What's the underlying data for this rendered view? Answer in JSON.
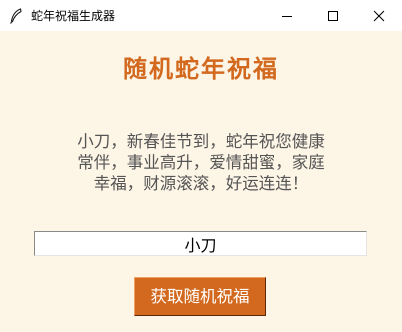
{
  "window": {
    "title": "蛇年祝福生成器",
    "icon": "feather-icon",
    "controls": {
      "minimize": "minimize-icon",
      "maximize": "maximize-icon",
      "close": "close-icon"
    }
  },
  "main": {
    "heading": "随机蛇年祝福",
    "message_lines": [
      "小刀，新春佳节到，蛇年祝您健康",
      "常伴，事业高升，爱情甜蜜，家庭",
      "幸福，财源滚滚，好运连连！"
    ],
    "name_input": {
      "value": "小刀"
    },
    "button_label": "获取随机祝福"
  },
  "colors": {
    "background": "#fdf5e6",
    "accent": "#d2691e",
    "message_text": "#555555",
    "button_text": "#ffffff"
  }
}
